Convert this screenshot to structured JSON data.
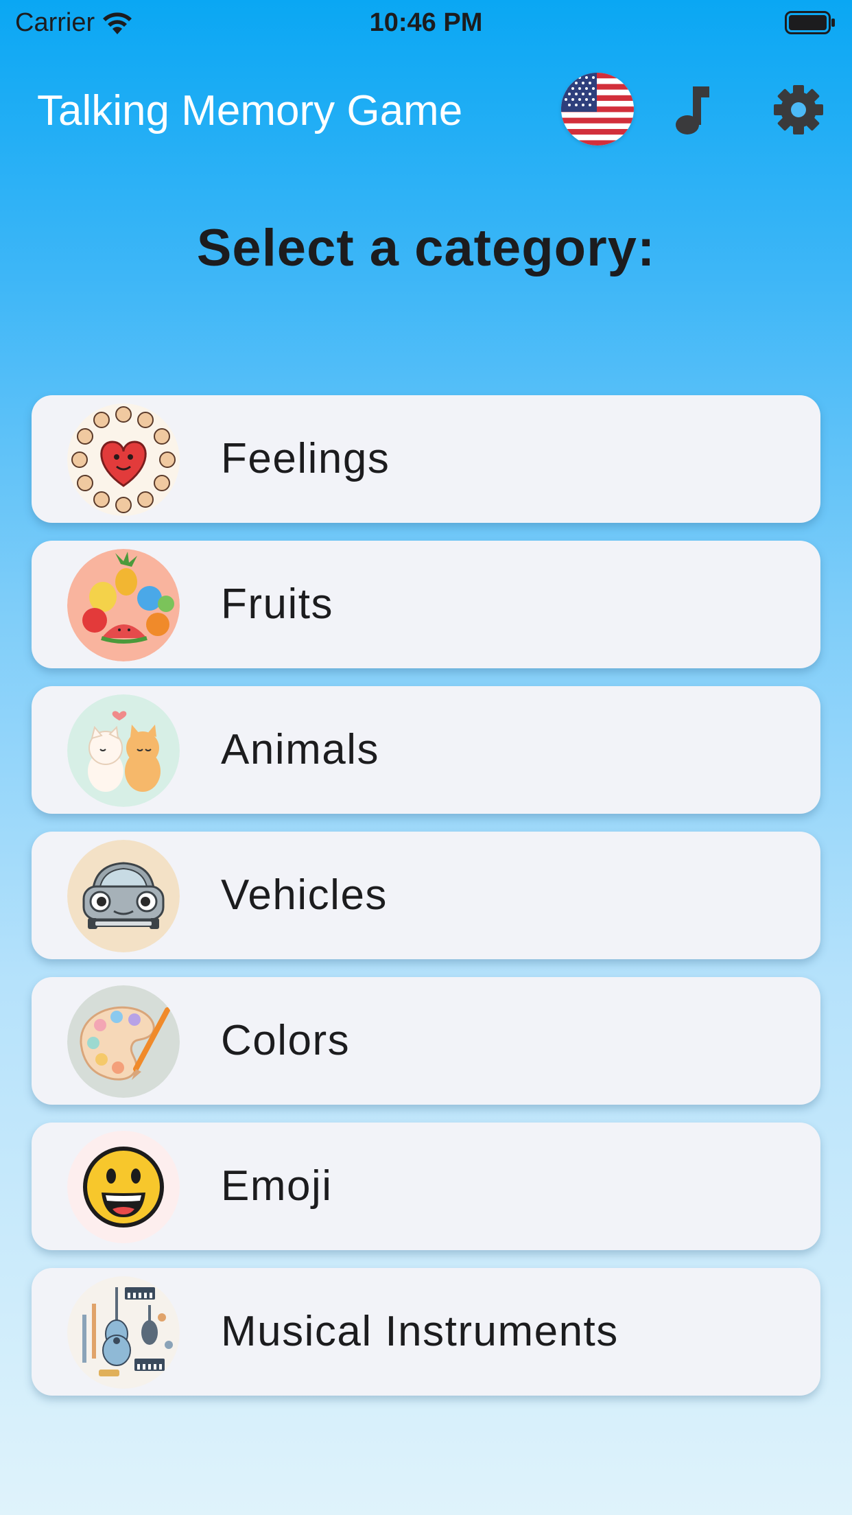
{
  "status_bar": {
    "carrier": "Carrier",
    "time": "10:46 PM",
    "icons": [
      "wifi-icon",
      "battery-icon"
    ]
  },
  "app_bar": {
    "title": "Talking Memory Game",
    "language_icon": "us-flag-icon",
    "music_icon": "music-note-icon",
    "settings_icon": "gear-icon"
  },
  "heading": "Select a category:",
  "categories": [
    {
      "label": "Feelings",
      "icon": "feelings-heart-icon"
    },
    {
      "label": "Fruits",
      "icon": "fruits-icon"
    },
    {
      "label": "Animals",
      "icon": "animals-icon"
    },
    {
      "label": "Vehicles",
      "icon": "car-icon"
    },
    {
      "label": "Colors",
      "icon": "paint-palette-icon"
    },
    {
      "label": "Emoji",
      "icon": "smiley-emoji-icon"
    },
    {
      "label": "Musical Instruments",
      "icon": "instruments-icon"
    }
  ],
  "colors": {
    "background_top": "#0aa7f3",
    "background_bottom": "#dff3fb",
    "card_background": "#f2f3f8",
    "title_text": "#ffffff",
    "body_text": "#1c1c1e"
  }
}
